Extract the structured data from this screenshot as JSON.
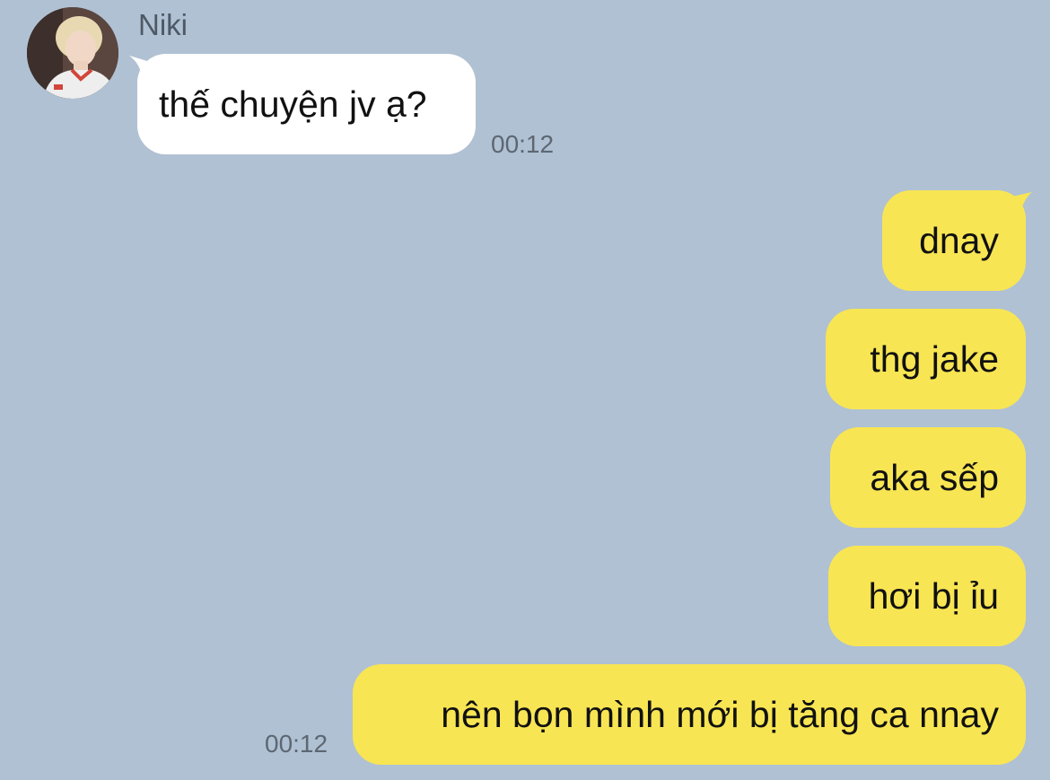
{
  "chat": {
    "contact_name": "Niki",
    "incoming": [
      {
        "text": "thế chuyện jv ạ?",
        "time": "00:12"
      }
    ],
    "outgoing": [
      {
        "text": "dnay"
      },
      {
        "text": "thg jake"
      },
      {
        "text": "aka sếp"
      },
      {
        "text": "hơi bị ỉu"
      },
      {
        "text": "nên bọn mình mới bị tăng ca nnay",
        "time": "00:12"
      }
    ]
  },
  "colors": {
    "background": "#b0c1d3",
    "incoming_bubble": "#ffffff",
    "outgoing_bubble": "#f8e553",
    "timestamp": "#5d6772"
  },
  "icons": {
    "avatar": "contact-avatar-photo"
  }
}
